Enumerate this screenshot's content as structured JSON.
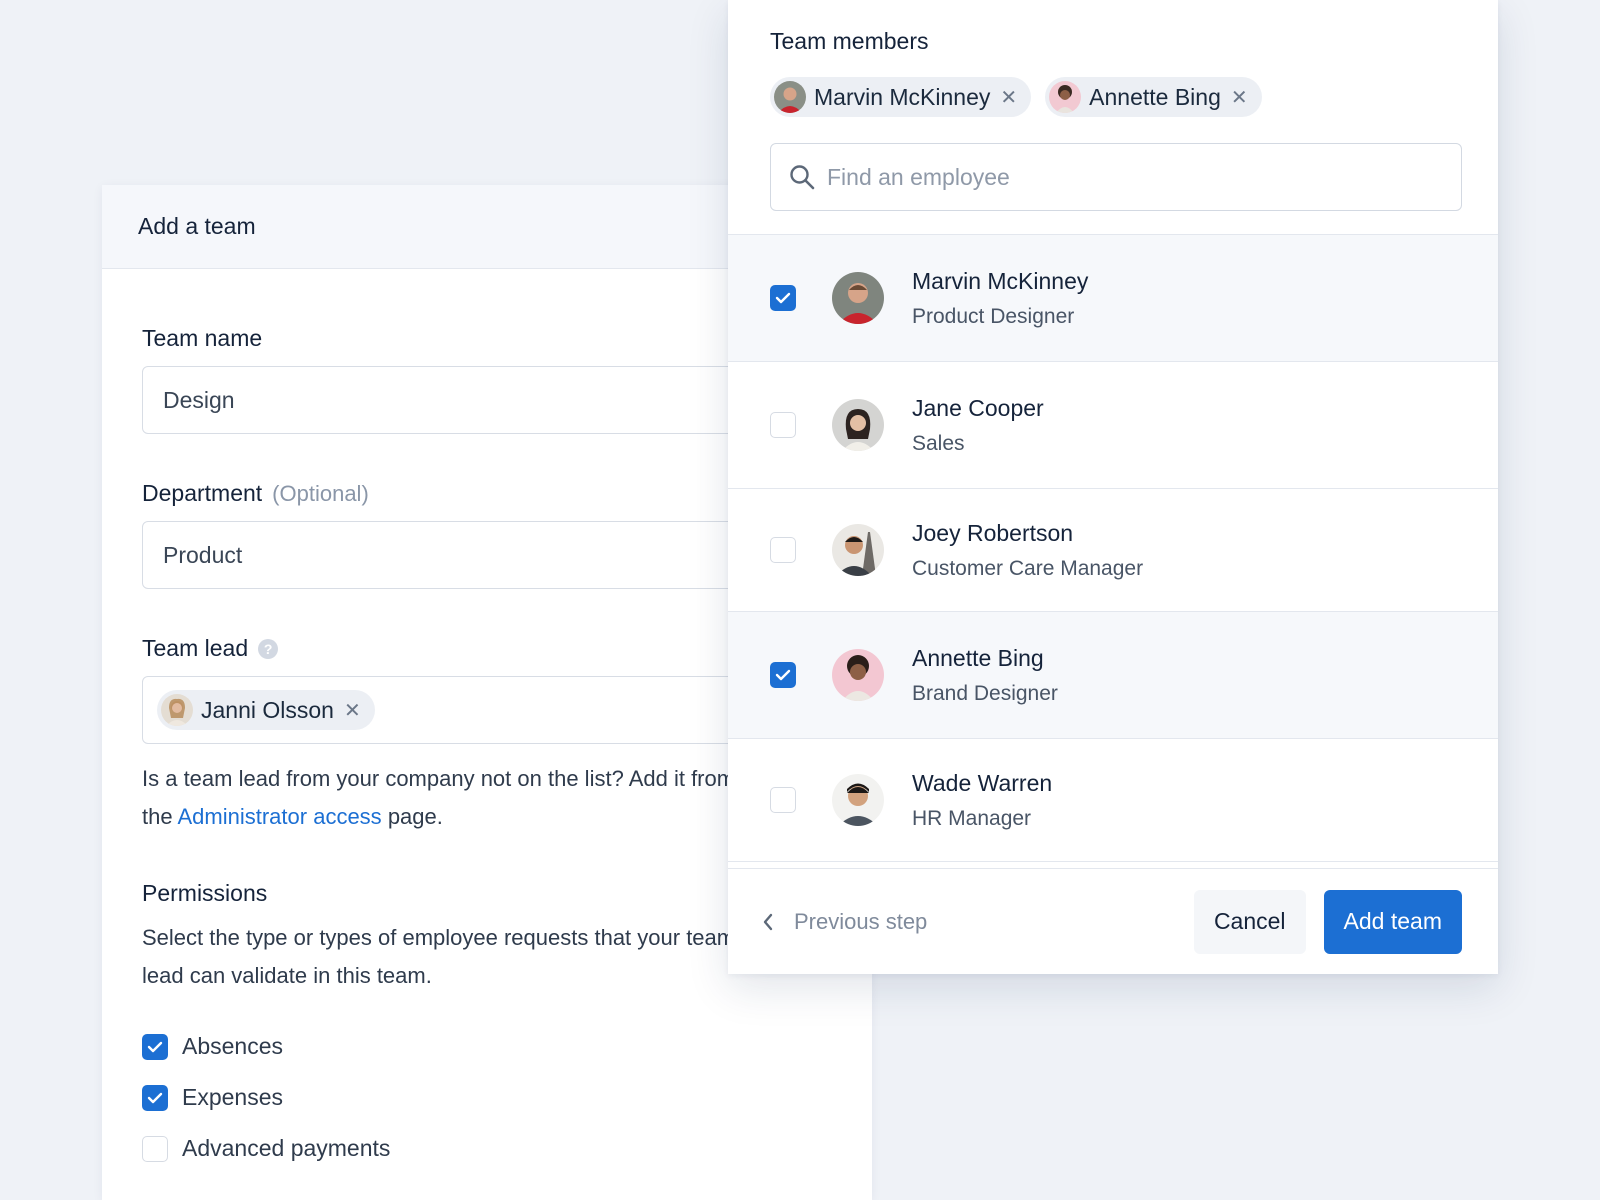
{
  "add_team": {
    "title": "Add a team",
    "team_name_label": "Team name",
    "team_name_value": "Design",
    "department_label": "Department",
    "department_optional": "(Optional)",
    "department_value": "Product",
    "team_lead_label": "Team lead",
    "team_lead_chip": "Janni Olsson",
    "helper_text_before": "Is a team lead from your company not on the list? Add it from the",
    "helper_link": "Administrator access",
    "helper_text_after": "page.",
    "permissions_title": "Permissions",
    "permissions_desc": "Select the type or types of employee requests that your team lead can validate in this team.",
    "permissions": [
      {
        "label": "Absences",
        "checked": true
      },
      {
        "label": "Expenses",
        "checked": true
      },
      {
        "label": "Advanced payments",
        "checked": false
      }
    ]
  },
  "team_members": {
    "title": "Team members",
    "chips": [
      "Marvin McKinney",
      "Annette Bing"
    ],
    "search_placeholder": "Find an employee",
    "employees": [
      {
        "name": "Marvin McKinney",
        "role": "Product Designer",
        "checked": true
      },
      {
        "name": "Jane Cooper",
        "role": "Sales",
        "checked": false
      },
      {
        "name": "Joey Robertson",
        "role": "Customer Care Manager",
        "checked": false
      },
      {
        "name": "Annette Bing",
        "role": "Brand Designer",
        "checked": true
      },
      {
        "name": "Wade Warren",
        "role": "HR Manager",
        "checked": false
      }
    ],
    "previous_step": "Previous step",
    "cancel": "Cancel",
    "add_team": "Add team"
  },
  "colors": {
    "primary": "#1c6fd3",
    "background": "#eff2f7"
  },
  "icons": {
    "remove": "close-icon",
    "search": "search-icon",
    "help": "help-icon",
    "back": "chevron-left-icon",
    "check": "check-icon"
  }
}
